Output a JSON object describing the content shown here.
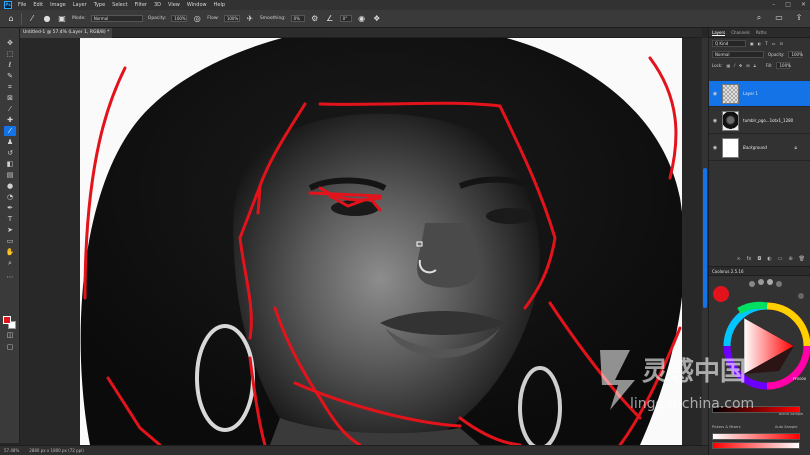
{
  "menubar": {
    "logo": "Ps",
    "items": [
      "File",
      "Edit",
      "Image",
      "Layer",
      "Type",
      "Select",
      "Filter",
      "3D",
      "View",
      "Window",
      "Help"
    ]
  },
  "options": {
    "mode_label": "Mode:",
    "mode_value": "Normal",
    "opacity_label": "Opacity:",
    "opacity_value": "100%",
    "flow_label": "Flow:",
    "flow_value": "100%",
    "smoothing_label": "Smoothing:",
    "smoothing_value": "0%",
    "angle_value": "0°"
  },
  "document": {
    "tab_title": "Untitled-1 @ 57.4% (Layer 1, RGB/8) *",
    "zoom": "57.48%",
    "dimensions": "2880 px x 1800 px (72 ppi)"
  },
  "layers_panel": {
    "tabs": [
      "Layers",
      "Channels",
      "Paths"
    ],
    "kind_filter": "Q Kind",
    "blend_mode": "Normal",
    "opacity_label": "Opacity:",
    "opacity_value": "100%",
    "lock_label": "Lock:",
    "fill_label": "Fill:",
    "fill_value": "100%",
    "layers": [
      {
        "name": "Layer 1",
        "thumb": "transparent",
        "selected": true
      },
      {
        "name": "tumblr_pgo...1otx1_1280",
        "thumb": "photo",
        "selected": false
      },
      {
        "name": "Background",
        "thumb": "white",
        "selected": false,
        "locked": true
      }
    ]
  },
  "color_panel": {
    "title": "Coolorus 2.5.16",
    "hex": "FF0000",
    "labels": [
      "Blend Sample",
      "Pickers & Mixers",
      "Auto Sample"
    ]
  },
  "watermark": {
    "text_cn": "灵感中国",
    "text_en": "lingganchina.com"
  },
  "colors": {
    "accent": "#1473e6",
    "foreground": "#e3131b",
    "background": "#ffffff",
    "stroke": "#e3131b"
  }
}
